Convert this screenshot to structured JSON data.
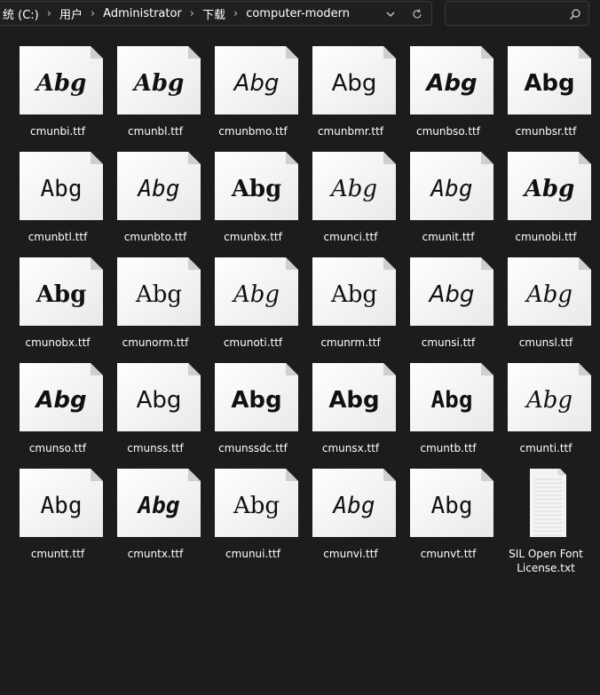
{
  "address_bar": {
    "breadcrumbs": [
      "统 (C:)",
      "用户",
      "Administrator",
      "下载",
      "computer-modern"
    ]
  },
  "search": {
    "placeholder": ""
  },
  "files": [
    {
      "name": "cmunbi.ttf",
      "sample": "Abg",
      "style": "bold-italic"
    },
    {
      "name": "cmunbl.ttf",
      "sample": "Abg",
      "style": "bold-italic"
    },
    {
      "name": "cmunbmo.ttf",
      "sample": "Abg",
      "style": "oblique"
    },
    {
      "name": "cmunbmr.ttf",
      "sample": "Abg",
      "style": "sans"
    },
    {
      "name": "cmunbso.ttf",
      "sample": "Abg",
      "style": "sans-bold-oblique"
    },
    {
      "name": "cmunbsr.ttf",
      "sample": "Abg",
      "style": "sans-bold"
    },
    {
      "name": "cmunbtl.ttf",
      "sample": "Abg",
      "style": "mono"
    },
    {
      "name": "cmunbto.ttf",
      "sample": "Abg",
      "style": "mono-oblique"
    },
    {
      "name": "cmunbx.ttf",
      "sample": "Abg",
      "style": "bold"
    },
    {
      "name": "cmunci.ttf",
      "sample": "Abg",
      "style": "italic"
    },
    {
      "name": "cmunit.ttf",
      "sample": "Abg",
      "style": "mono-italic"
    },
    {
      "name": "cmunobi.ttf",
      "sample": "Abg",
      "style": "bold-italic"
    },
    {
      "name": "cmunobx.ttf",
      "sample": "Abg",
      "style": "bold"
    },
    {
      "name": "cmunorm.ttf",
      "sample": "Abg",
      "style": "regular"
    },
    {
      "name": "cmunoti.ttf",
      "sample": "Abg",
      "style": "italic"
    },
    {
      "name": "cmunrm.ttf",
      "sample": "Abg",
      "style": "regular"
    },
    {
      "name": "cmunsi.ttf",
      "sample": "Abg",
      "style": "sans-oblique"
    },
    {
      "name": "cmunsl.ttf",
      "sample": "Abg",
      "style": "italic"
    },
    {
      "name": "cmunso.ttf",
      "sample": "Abg",
      "style": "sans-bold-oblique"
    },
    {
      "name": "cmunss.ttf",
      "sample": "Abg",
      "style": "sans"
    },
    {
      "name": "cmunssdc.ttf",
      "sample": "Abg",
      "style": "sans-bold"
    },
    {
      "name": "cmunsx.ttf",
      "sample": "Abg",
      "style": "sans-bold"
    },
    {
      "name": "cmuntb.ttf",
      "sample": "Abg",
      "style": "mono-bold"
    },
    {
      "name": "cmunti.ttf",
      "sample": "Abg",
      "style": "italic"
    },
    {
      "name": "cmuntt.ttf",
      "sample": "Abg",
      "style": "mono"
    },
    {
      "name": "cmuntx.ttf",
      "sample": "Abg",
      "style": "mono-bold-italic"
    },
    {
      "name": "cmunui.ttf",
      "sample": "Abg",
      "style": "regular"
    },
    {
      "name": "cmunvi.ttf",
      "sample": "Abg",
      "style": "mono-italic"
    },
    {
      "name": "cmunvt.ttf",
      "sample": "Abg",
      "style": "mono"
    },
    {
      "name": "SIL Open Font License.txt",
      "sample": "",
      "style": "text-file"
    }
  ]
}
